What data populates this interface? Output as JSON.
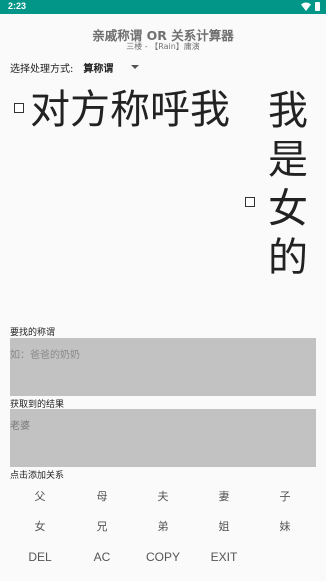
{
  "status_bar": {
    "time": "2:23",
    "icons": [
      "wifi-icon",
      "battery-icon"
    ]
  },
  "header": {
    "title": "亲戚称谓 OR 关系计算器",
    "subtitle": "三楼 - 【Rain】庸演"
  },
  "mode": {
    "label": "选择处理方式:",
    "selected": "算称谓"
  },
  "display": {
    "left_text": "对方称呼我",
    "right_text": "我是女的"
  },
  "find": {
    "label": "要找的称谓",
    "placeholder": "如：爸爸的奶奶"
  },
  "result": {
    "label": "获取到的结果",
    "value": "老婆"
  },
  "add": {
    "label": "点击添加关系"
  },
  "keys": {
    "father": "父",
    "mother": "母",
    "husband": "夫",
    "wife": "妻",
    "son": "子",
    "daughter": "女",
    "elder_brother": "兄",
    "younger_brother": "弟",
    "elder_sister": "姐",
    "younger_sister": "妹",
    "del": "DEL",
    "ac": "AC",
    "copy": "COPY",
    "exit": "EXIT"
  },
  "colors": {
    "status_bar": "#029688",
    "input_bg": "#c2c2c2",
    "background": "#fafafa"
  }
}
